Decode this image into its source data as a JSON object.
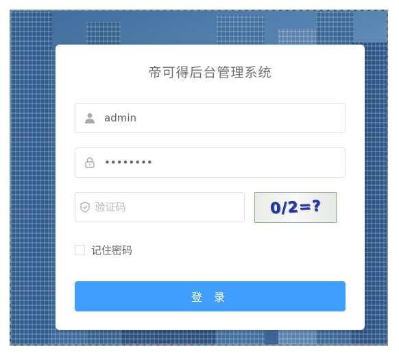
{
  "login": {
    "title": "帝可得后台管理系统",
    "username": {
      "value": "admin",
      "placeholder": ""
    },
    "password": {
      "value": "••••••••",
      "placeholder": ""
    },
    "captcha_input": {
      "value": "",
      "placeholder": "验证码"
    },
    "captcha_image_text": "0/2=?",
    "remember_label": "记住密码",
    "remember_checked": false,
    "submit_label": "登 录"
  },
  "icons": {
    "username": "user-icon",
    "password": "lock-icon",
    "captcha": "shield-icon"
  },
  "colors": {
    "primary": "#409eff",
    "title": "#707070",
    "border": "#dcdfe6",
    "background": "#4c77a6"
  }
}
